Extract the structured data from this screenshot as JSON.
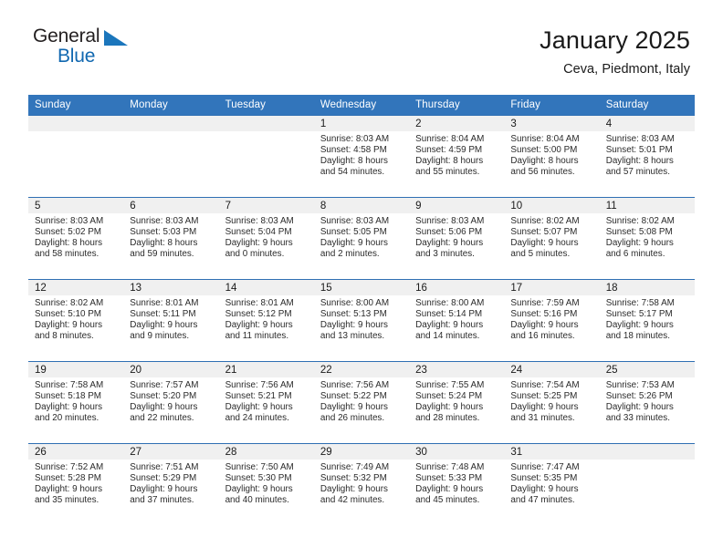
{
  "brand": {
    "word_one": "General",
    "word_two": "Blue",
    "flag_icon": "brand-triangle-icon"
  },
  "header": {
    "title": "January 2025",
    "subtitle": "Ceva, Piedmont, Italy"
  },
  "colors": {
    "header_row": "#3275bb",
    "cell_divider": "#2f6fb3",
    "daynum_strip": "#f0f0f0",
    "brand_blue": "#1168b0"
  },
  "weekday_headers": [
    "Sunday",
    "Monday",
    "Tuesday",
    "Wednesday",
    "Thursday",
    "Friday",
    "Saturday"
  ],
  "weeks": [
    [
      {
        "day": "",
        "empty": true
      },
      {
        "day": "",
        "empty": true
      },
      {
        "day": "",
        "empty": true
      },
      {
        "day": "1",
        "sunrise": "Sunrise: 8:03 AM",
        "sunset": "Sunset: 4:58 PM",
        "daylight_line1": "Daylight: 8 hours",
        "daylight_line2": "and 54 minutes."
      },
      {
        "day": "2",
        "sunrise": "Sunrise: 8:04 AM",
        "sunset": "Sunset: 4:59 PM",
        "daylight_line1": "Daylight: 8 hours",
        "daylight_line2": "and 55 minutes."
      },
      {
        "day": "3",
        "sunrise": "Sunrise: 8:04 AM",
        "sunset": "Sunset: 5:00 PM",
        "daylight_line1": "Daylight: 8 hours",
        "daylight_line2": "and 56 minutes."
      },
      {
        "day": "4",
        "sunrise": "Sunrise: 8:03 AM",
        "sunset": "Sunset: 5:01 PM",
        "daylight_line1": "Daylight: 8 hours",
        "daylight_line2": "and 57 minutes."
      }
    ],
    [
      {
        "day": "5",
        "sunrise": "Sunrise: 8:03 AM",
        "sunset": "Sunset: 5:02 PM",
        "daylight_line1": "Daylight: 8 hours",
        "daylight_line2": "and 58 minutes."
      },
      {
        "day": "6",
        "sunrise": "Sunrise: 8:03 AM",
        "sunset": "Sunset: 5:03 PM",
        "daylight_line1": "Daylight: 8 hours",
        "daylight_line2": "and 59 minutes."
      },
      {
        "day": "7",
        "sunrise": "Sunrise: 8:03 AM",
        "sunset": "Sunset: 5:04 PM",
        "daylight_line1": "Daylight: 9 hours",
        "daylight_line2": "and 0 minutes."
      },
      {
        "day": "8",
        "sunrise": "Sunrise: 8:03 AM",
        "sunset": "Sunset: 5:05 PM",
        "daylight_line1": "Daylight: 9 hours",
        "daylight_line2": "and 2 minutes."
      },
      {
        "day": "9",
        "sunrise": "Sunrise: 8:03 AM",
        "sunset": "Sunset: 5:06 PM",
        "daylight_line1": "Daylight: 9 hours",
        "daylight_line2": "and 3 minutes."
      },
      {
        "day": "10",
        "sunrise": "Sunrise: 8:02 AM",
        "sunset": "Sunset: 5:07 PM",
        "daylight_line1": "Daylight: 9 hours",
        "daylight_line2": "and 5 minutes."
      },
      {
        "day": "11",
        "sunrise": "Sunrise: 8:02 AM",
        "sunset": "Sunset: 5:08 PM",
        "daylight_line1": "Daylight: 9 hours",
        "daylight_line2": "and 6 minutes."
      }
    ],
    [
      {
        "day": "12",
        "sunrise": "Sunrise: 8:02 AM",
        "sunset": "Sunset: 5:10 PM",
        "daylight_line1": "Daylight: 9 hours",
        "daylight_line2": "and 8 minutes."
      },
      {
        "day": "13",
        "sunrise": "Sunrise: 8:01 AM",
        "sunset": "Sunset: 5:11 PM",
        "daylight_line1": "Daylight: 9 hours",
        "daylight_line2": "and 9 minutes."
      },
      {
        "day": "14",
        "sunrise": "Sunrise: 8:01 AM",
        "sunset": "Sunset: 5:12 PM",
        "daylight_line1": "Daylight: 9 hours",
        "daylight_line2": "and 11 minutes."
      },
      {
        "day": "15",
        "sunrise": "Sunrise: 8:00 AM",
        "sunset": "Sunset: 5:13 PM",
        "daylight_line1": "Daylight: 9 hours",
        "daylight_line2": "and 13 minutes."
      },
      {
        "day": "16",
        "sunrise": "Sunrise: 8:00 AM",
        "sunset": "Sunset: 5:14 PM",
        "daylight_line1": "Daylight: 9 hours",
        "daylight_line2": "and 14 minutes."
      },
      {
        "day": "17",
        "sunrise": "Sunrise: 7:59 AM",
        "sunset": "Sunset: 5:16 PM",
        "daylight_line1": "Daylight: 9 hours",
        "daylight_line2": "and 16 minutes."
      },
      {
        "day": "18",
        "sunrise": "Sunrise: 7:58 AM",
        "sunset": "Sunset: 5:17 PM",
        "daylight_line1": "Daylight: 9 hours",
        "daylight_line2": "and 18 minutes."
      }
    ],
    [
      {
        "day": "19",
        "sunrise": "Sunrise: 7:58 AM",
        "sunset": "Sunset: 5:18 PM",
        "daylight_line1": "Daylight: 9 hours",
        "daylight_line2": "and 20 minutes."
      },
      {
        "day": "20",
        "sunrise": "Sunrise: 7:57 AM",
        "sunset": "Sunset: 5:20 PM",
        "daylight_line1": "Daylight: 9 hours",
        "daylight_line2": "and 22 minutes."
      },
      {
        "day": "21",
        "sunrise": "Sunrise: 7:56 AM",
        "sunset": "Sunset: 5:21 PM",
        "daylight_line1": "Daylight: 9 hours",
        "daylight_line2": "and 24 minutes."
      },
      {
        "day": "22",
        "sunrise": "Sunrise: 7:56 AM",
        "sunset": "Sunset: 5:22 PM",
        "daylight_line1": "Daylight: 9 hours",
        "daylight_line2": "and 26 minutes."
      },
      {
        "day": "23",
        "sunrise": "Sunrise: 7:55 AM",
        "sunset": "Sunset: 5:24 PM",
        "daylight_line1": "Daylight: 9 hours",
        "daylight_line2": "and 28 minutes."
      },
      {
        "day": "24",
        "sunrise": "Sunrise: 7:54 AM",
        "sunset": "Sunset: 5:25 PM",
        "daylight_line1": "Daylight: 9 hours",
        "daylight_line2": "and 31 minutes."
      },
      {
        "day": "25",
        "sunrise": "Sunrise: 7:53 AM",
        "sunset": "Sunset: 5:26 PM",
        "daylight_line1": "Daylight: 9 hours",
        "daylight_line2": "and 33 minutes."
      }
    ],
    [
      {
        "day": "26",
        "sunrise": "Sunrise: 7:52 AM",
        "sunset": "Sunset: 5:28 PM",
        "daylight_line1": "Daylight: 9 hours",
        "daylight_line2": "and 35 minutes."
      },
      {
        "day": "27",
        "sunrise": "Sunrise: 7:51 AM",
        "sunset": "Sunset: 5:29 PM",
        "daylight_line1": "Daylight: 9 hours",
        "daylight_line2": "and 37 minutes."
      },
      {
        "day": "28",
        "sunrise": "Sunrise: 7:50 AM",
        "sunset": "Sunset: 5:30 PM",
        "daylight_line1": "Daylight: 9 hours",
        "daylight_line2": "and 40 minutes."
      },
      {
        "day": "29",
        "sunrise": "Sunrise: 7:49 AM",
        "sunset": "Sunset: 5:32 PM",
        "daylight_line1": "Daylight: 9 hours",
        "daylight_line2": "and 42 minutes."
      },
      {
        "day": "30",
        "sunrise": "Sunrise: 7:48 AM",
        "sunset": "Sunset: 5:33 PM",
        "daylight_line1": "Daylight: 9 hours",
        "daylight_line2": "and 45 minutes."
      },
      {
        "day": "31",
        "sunrise": "Sunrise: 7:47 AM",
        "sunset": "Sunset: 5:35 PM",
        "daylight_line1": "Daylight: 9 hours",
        "daylight_line2": "and 47 minutes."
      },
      {
        "day": "",
        "empty": true
      }
    ]
  ]
}
